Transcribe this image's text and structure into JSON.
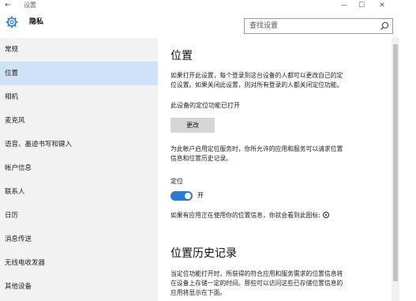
{
  "window": {
    "back_glyph": "←",
    "title": "设置",
    "minimize_glyph": "—",
    "maximize_glyph": "☐",
    "close_glyph": "✕"
  },
  "header": {
    "icon": "gear-icon",
    "title": "隐私"
  },
  "search": {
    "placeholder": "查找设置",
    "icon": "search-icon"
  },
  "sidebar": {
    "items": [
      {
        "label": "常规",
        "active": false
      },
      {
        "label": "位置",
        "active": true
      },
      {
        "label": "相机",
        "active": false
      },
      {
        "label": "麦克风",
        "active": false
      },
      {
        "label": "语音、墨迹书写和键入",
        "active": false
      },
      {
        "label": "帐户信息",
        "active": false
      },
      {
        "label": "联系人",
        "active": false
      },
      {
        "label": "日历",
        "active": false
      },
      {
        "label": "消息传送",
        "active": false
      },
      {
        "label": "无线电收发器",
        "active": false
      },
      {
        "label": "其他设备",
        "active": false
      }
    ]
  },
  "main": {
    "title": "位置",
    "intro_line1": "如果打开此设置，每个登录到这台设备的人都可以更改自己的定",
    "intro_line2": "位设置。如果关闭此设置，则对所有登录的人都关闭定位功能。",
    "device_status": "此设备的定位功能已打开",
    "change_button": "更改",
    "account_line1": "为此帐户启用定位服务时，你所允许的应用和服务可以请求位置",
    "account_line2": "信息和位置历史记录。",
    "location_label": "定位",
    "toggle": {
      "state": "on",
      "label": "开"
    },
    "icon_note": "如果有应用正在使用你的位置信息，你就会看到此图标:",
    "history_title": "位置历史记录",
    "history_line1": "当定位功能打开时，所获得的符合应用和服务需求的位置信息将",
    "history_line2": "在设备上存储一定的时间。那些可以访问这些已存储位置信息的",
    "history_line3": "应用将显示在下面。"
  },
  "colors": {
    "accent": "#2a7ad2",
    "sidebar_bg": "#f2f2f2",
    "active_item_bg": "#cfe3f7",
    "button_bg": "#d6d6d6"
  }
}
